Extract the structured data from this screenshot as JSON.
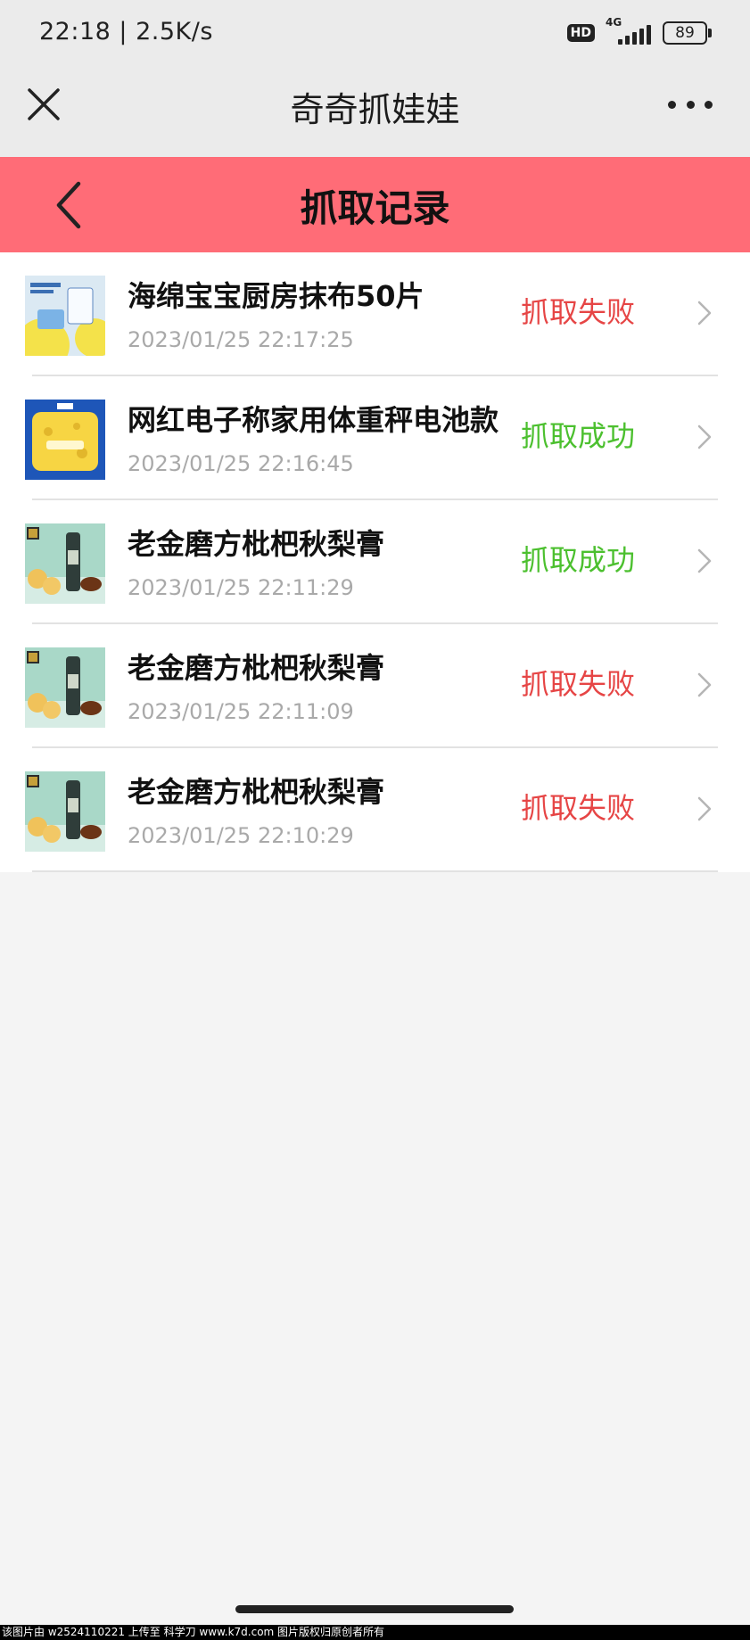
{
  "status_bar": {
    "time_speed": "22:18 | 2.5K/s",
    "hd": "HD",
    "network": "4G",
    "battery": "89"
  },
  "titlebar": {
    "title": "奇奇抓娃娃",
    "close_icon": "close-icon",
    "more_icon": "more-icon"
  },
  "header": {
    "title": "抓取记录",
    "back_icon": "back-arrow-icon",
    "bg_color": "#ff6c77"
  },
  "colors": {
    "fail": "#e64545",
    "success": "#4cc02f"
  },
  "records": [
    {
      "name": "海绵宝宝厨房抹布50片",
      "time": "2023/01/25 22:17:25",
      "status": "抓取失败",
      "result": "fail",
      "thumb": "sponge-cloth"
    },
    {
      "name": "网红电子称家用体重秤电池款",
      "time": "2023/01/25 22:16:45",
      "status": "抓取成功",
      "result": "success",
      "thumb": "scale"
    },
    {
      "name": "老金磨方枇杷秋梨膏",
      "time": "2023/01/25 22:11:29",
      "status": "抓取成功",
      "result": "success",
      "thumb": "pear-syrup"
    },
    {
      "name": "老金磨方枇杷秋梨膏",
      "time": "2023/01/25 22:11:09",
      "status": "抓取失败",
      "result": "fail",
      "thumb": "pear-syrup"
    },
    {
      "name": "老金磨方枇杷秋梨膏",
      "time": "2023/01/25 22:10:29",
      "status": "抓取失败",
      "result": "fail",
      "thumb": "pear-syrup"
    }
  ],
  "watermark": "该图片由  w2524110221  上传至  科学刀  www.k7d.com   图片版权归原创者所有"
}
